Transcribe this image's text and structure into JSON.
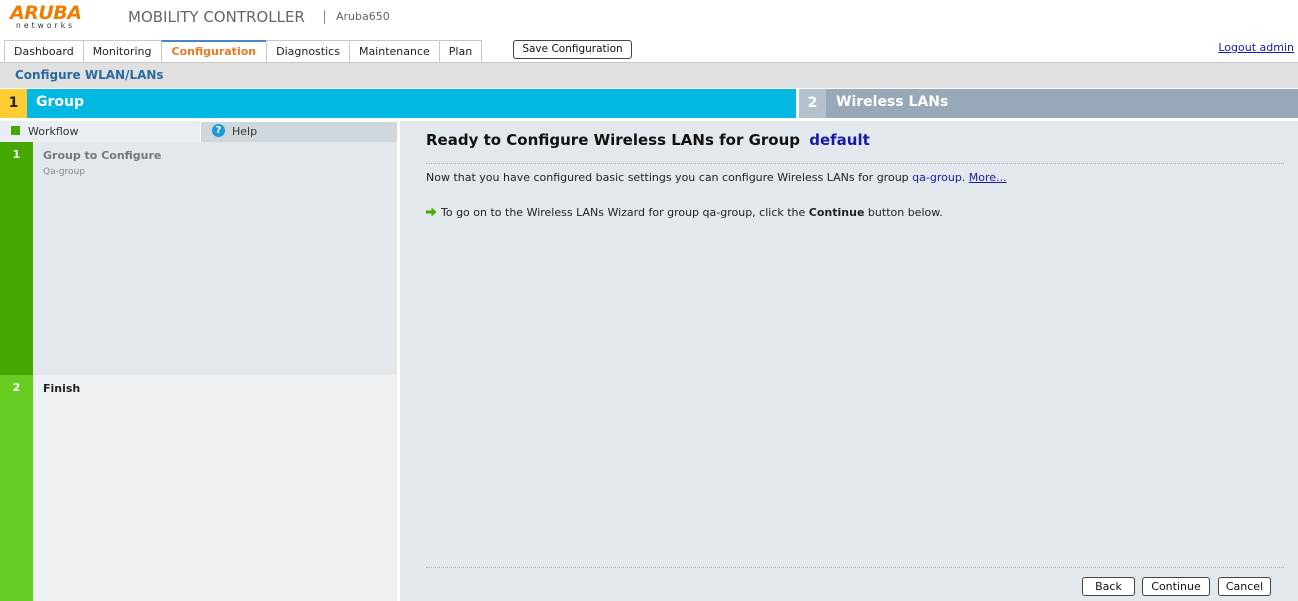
{
  "header": {
    "logo_text": "ARUBA",
    "logo_sub": "networks",
    "product_title": "MOBILITY CONTROLLER",
    "device_name": "Aruba650"
  },
  "tabs": [
    {
      "label": "Dashboard"
    },
    {
      "label": "Monitoring"
    },
    {
      "label": "Configuration",
      "active": true
    },
    {
      "label": "Diagnostics"
    },
    {
      "label": "Maintenance"
    },
    {
      "label": "Plan"
    }
  ],
  "toolbar": {
    "save_label": "Save Configuration",
    "logout_label": "Logout admin"
  },
  "subheader": {
    "title": "Configure WLAN/LANs"
  },
  "steps": [
    {
      "number": "1",
      "label": "Group"
    },
    {
      "number": "2",
      "label": "Wireless LANs"
    }
  ],
  "left_tabs": {
    "workflow_label": "Workflow",
    "help_label": "Help",
    "help_icon": "?"
  },
  "workflow": [
    {
      "number": "1",
      "title": "Group to Configure",
      "subtitle": "Qa-group"
    },
    {
      "number": "2",
      "title": "Finish"
    }
  ],
  "main": {
    "title_prefix": "Ready to Configure Wireless LANs for Group",
    "title_group": "default",
    "para_prefix": "Now that you have configured basic settings you can configure Wireless LANs for group",
    "para_group": "qa-group",
    "para_more": "More...",
    "next_prefix": "To go on to the Wireless LANs Wizard for group qa-group, click the",
    "next_bold": "Continue",
    "next_suffix": "button below."
  },
  "buttons": {
    "back": "Back",
    "continue": "Continue",
    "cancel": "Cancel"
  },
  "colors": {
    "accent_orange": "#f07d00",
    "step_active": "#00b8e0",
    "step_number_active": "#ffcc33",
    "step_inactive": "#97a8b8",
    "workflow_green": "#44a800",
    "workflow_green_light": "#66cc22",
    "link_blue": "#1a1aa6"
  }
}
